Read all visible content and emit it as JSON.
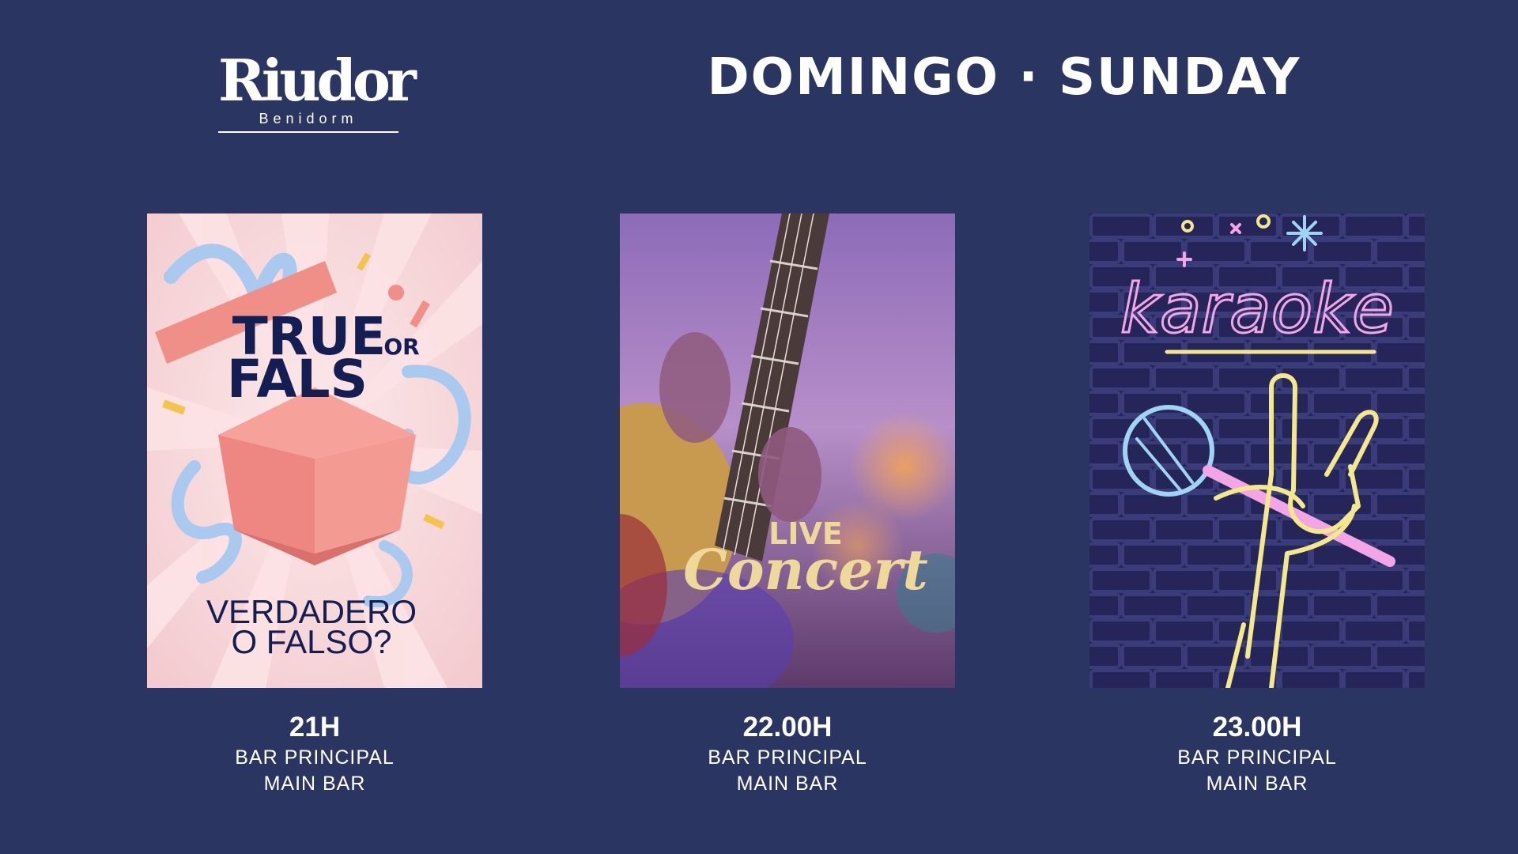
{
  "brand": {
    "logo_text": "Riudor",
    "location": "Benidorm"
  },
  "day_title": "DOMINGO · SUNDAY",
  "events": [
    {
      "poster": {
        "line1": "TRUE",
        "or": "OR",
        "line2": "FALS",
        "sub1": "VERDADERO",
        "sub2": "O FALSO?"
      },
      "time": "21H",
      "venue_es": "BAR PRINCIPAL",
      "venue_en": "MAIN BAR"
    },
    {
      "poster": {
        "line1": "LIVE",
        "line2": "Concert"
      },
      "time": "22.00H",
      "venue_es": "BAR PRINCIPAL",
      "venue_en": "MAIN BAR"
    },
    {
      "poster": {
        "line1": "karaoke"
      },
      "time": "23.00H",
      "venue_es": "BAR PRINCIPAL",
      "venue_en": "MAIN BAR"
    }
  ],
  "colors": {
    "background": "#2b3562",
    "navy_text": "#141e52",
    "neon_pink": "#f2a6e6",
    "neon_yellow": "#f4e98a",
    "neon_blue": "#9fd4f5",
    "concert_gold": "#efd99a"
  },
  "icons": [
    "gift-box-icon",
    "guitar-photo",
    "microphone-icon",
    "rock-hand-icon"
  ]
}
